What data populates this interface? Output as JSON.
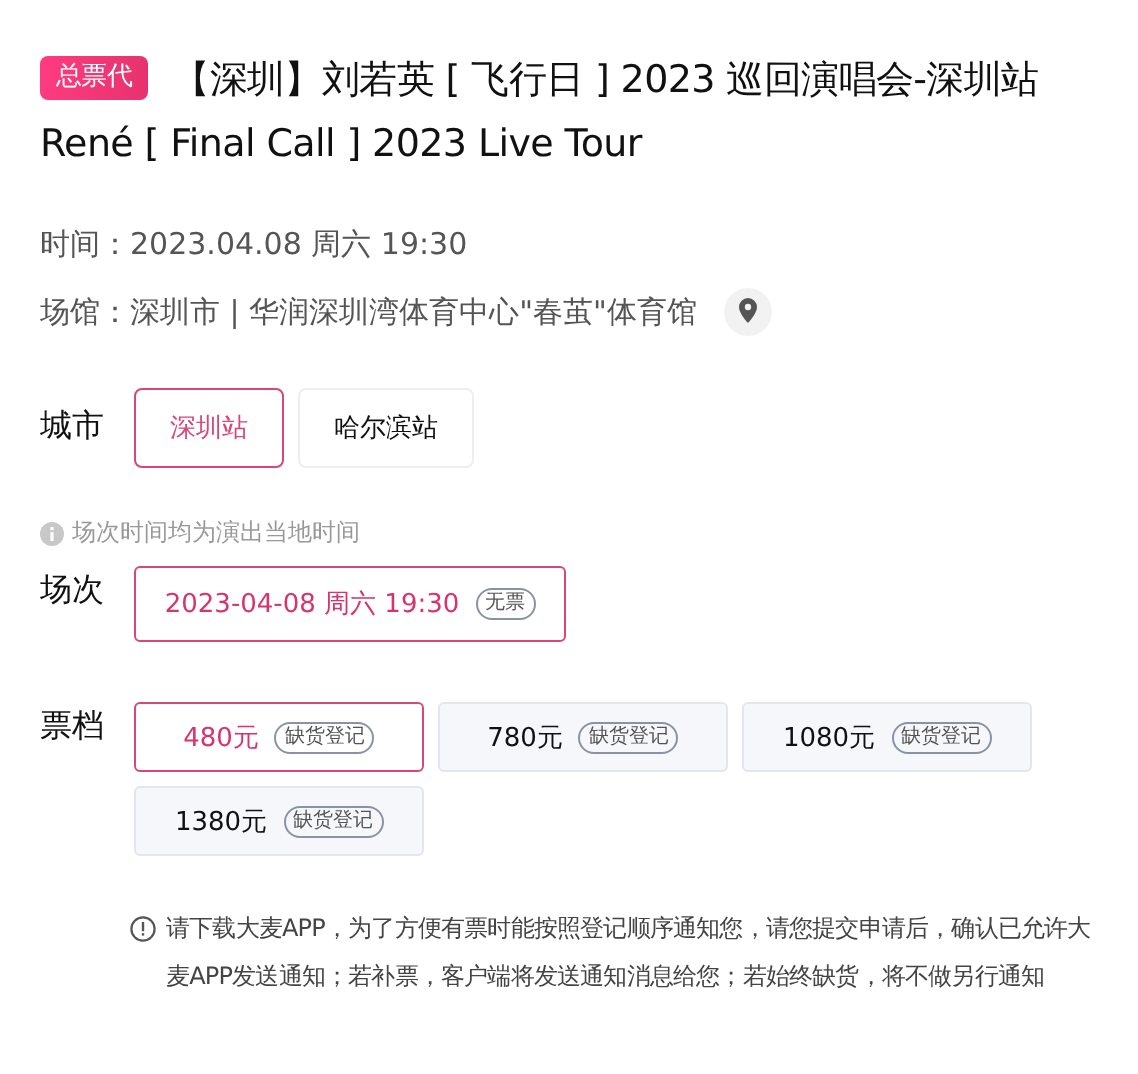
{
  "badge": "总票代",
  "title": "【深圳】刘若英 [ 飞行日 ] 2023 巡回演唱会-深圳站René [ Final Call ] 2023 Live Tour",
  "info": [
    {
      "label": "时间：",
      "value": "2023.04.08 周六 19:30",
      "kind": "text"
    },
    {
      "label": "场馆：",
      "value": "深圳市 | 华润深圳湾体育中心\"春茧\"体育馆",
      "kind": "location"
    }
  ],
  "city": {
    "label": "城市",
    "options": [
      {
        "label": "深圳站",
        "selected": true
      },
      {
        "label": "哈尔滨站",
        "selected": false
      }
    ]
  },
  "session_note": "场次时间均为演出当地时间",
  "session": {
    "label": "场次",
    "options": [
      {
        "label": "2023-04-08 周六 19:30",
        "tag": "无票",
        "selected": true
      }
    ]
  },
  "tiers": {
    "label": "票档",
    "options": [
      {
        "price": "480元",
        "tag": "缺货登记",
        "selected": true
      },
      {
        "price": "780元",
        "tag": "缺货登记",
        "selected": false
      },
      {
        "price": "1080元",
        "tag": "缺货登记",
        "selected": false
      },
      {
        "price": "1380元",
        "tag": "缺货登记",
        "selected": false
      }
    ]
  },
  "notice": "请下载大麦APP，为了方便有票时能按照登记顺序通知您，请您提交申请后，确认已允许大麦APP发送通知；若补票，客户端将发送通知消息给您；若始终缺货，将不做另行通知"
}
